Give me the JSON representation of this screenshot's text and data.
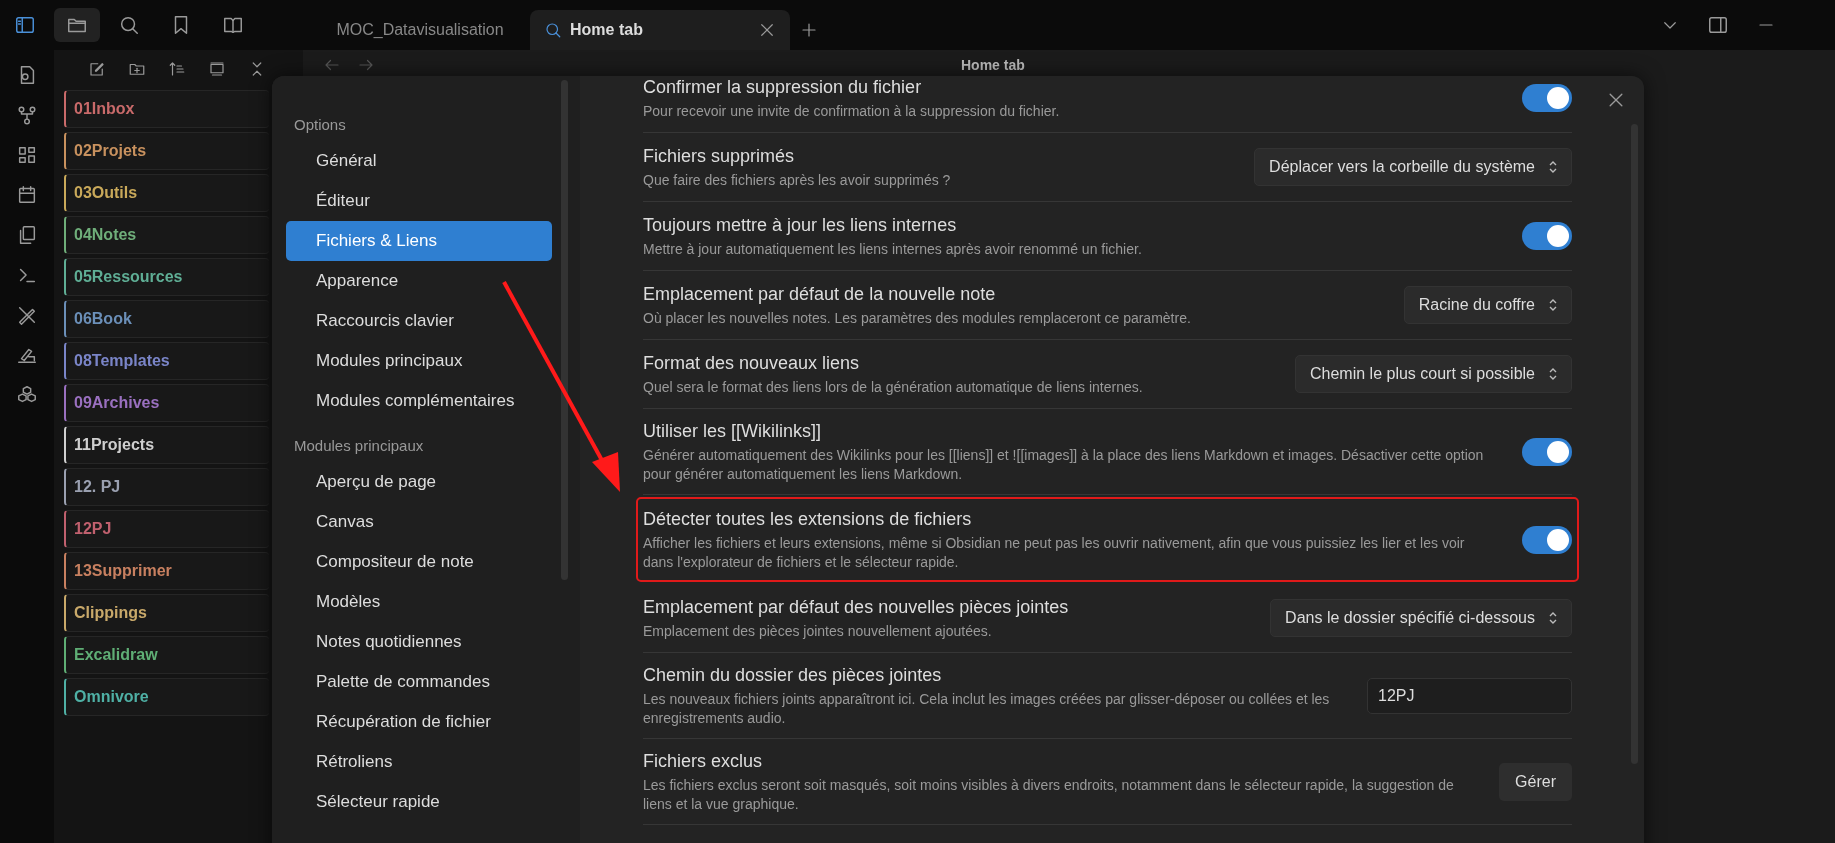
{
  "tabs": [
    {
      "label": "MOC_Datavisualisation",
      "selected": false
    },
    {
      "label": "Home tab",
      "selected": true
    }
  ],
  "view_title": "Home tab",
  "folders": [
    {
      "name": "01Inbox",
      "color": "#c96a6a"
    },
    {
      "name": "02Projets",
      "color": "#c8915e"
    },
    {
      "name": "03Outils",
      "color": "#c9a95a"
    },
    {
      "name": "04Notes",
      "color": "#6fae7a"
    },
    {
      "name": "05Ressources",
      "color": "#5fae95"
    },
    {
      "name": "06Book",
      "color": "#6b8fb8"
    },
    {
      "name": "08Templates",
      "color": "#7a85c8"
    },
    {
      "name": "09Archives",
      "color": "#9a70c0"
    },
    {
      "name": "11Projects",
      "color": "#cfcfcf"
    },
    {
      "name": "12. PJ",
      "color": "#9aa0b0"
    },
    {
      "name": "12PJ",
      "color": "#c0606e"
    },
    {
      "name": "13Supprimer",
      "color": "#c88060"
    },
    {
      "name": "Clippings",
      "color": "#c9a96a"
    },
    {
      "name": "Excalidraw",
      "color": "#5fae75"
    },
    {
      "name": "Omnivore",
      "color": "#4fb0a5"
    }
  ],
  "settings_nav": [
    {
      "heading": "Options",
      "items": [
        {
          "label": "Général",
          "selected": false
        },
        {
          "label": "Éditeur",
          "selected": false
        },
        {
          "label": "Fichiers & Liens",
          "selected": true
        },
        {
          "label": "Apparence",
          "selected": false
        },
        {
          "label": "Raccourcis clavier",
          "selected": false
        },
        {
          "label": "Modules principaux",
          "selected": false
        },
        {
          "label": "Modules complémentaires",
          "selected": false
        }
      ]
    },
    {
      "heading": "Modules principaux",
      "items": [
        {
          "label": "Aperçu de page",
          "selected": false
        },
        {
          "label": "Canvas",
          "selected": false
        },
        {
          "label": "Compositeur de note",
          "selected": false
        },
        {
          "label": "Modèles",
          "selected": false
        },
        {
          "label": "Notes quotidiennes",
          "selected": false
        },
        {
          "label": "Palette de commandes",
          "selected": false
        },
        {
          "label": "Récupération de fichier",
          "selected": false
        },
        {
          "label": "Rétroliens",
          "selected": false
        },
        {
          "label": "Sélecteur rapide",
          "selected": false
        }
      ]
    }
  ],
  "settings": [
    {
      "kind": "toggle",
      "title": "Confirmer la suppression du fichier",
      "description": "Pour recevoir une invite de confirmation à la suppression du fichier.",
      "on": true,
      "highlighted": false
    },
    {
      "kind": "dropdown",
      "title": "Fichiers supprimés",
      "description": "Que faire des fichiers après les avoir supprimés ?",
      "value": "Déplacer vers la corbeille du système",
      "highlighted": false
    },
    {
      "kind": "toggle",
      "title": "Toujours mettre à jour les liens internes",
      "description": "Mettre à jour automatiquement les liens internes après avoir renommé un fichier.",
      "on": true,
      "highlighted": false
    },
    {
      "kind": "dropdown",
      "title": "Emplacement par défaut de la nouvelle note",
      "description": "Où placer les nouvelles notes. Les paramètres des modules remplaceront ce paramètre.",
      "value": "Racine du coffre",
      "highlighted": false
    },
    {
      "kind": "dropdown",
      "title": "Format des nouveaux liens",
      "description": "Quel sera le format des liens lors de la génération automatique de liens internes.",
      "value": "Chemin le plus court si possible",
      "highlighted": false
    },
    {
      "kind": "toggle",
      "title": "Utiliser les [[Wikilinks]]",
      "description": "Générer automatiquement des Wikilinks pour les [[liens]] et ![[images]] à la place des liens Markdown et images. Désactiver cette option pour générer automatiquement les liens Markdown.",
      "on": true,
      "highlighted": false
    },
    {
      "kind": "toggle",
      "title": "Détecter toutes les extensions de fichiers",
      "description": "Afficher les fichiers et leurs extensions, même si Obsidian ne peut pas les ouvrir nativement, afin que vous puissiez les lier et les voir dans l'explorateur de fichiers et le sélecteur rapide.",
      "on": true,
      "highlighted": true
    },
    {
      "kind": "dropdown",
      "title": "Emplacement par défaut des nouvelles pièces jointes",
      "description": "Emplacement des pièces jointes nouvellement ajoutées.",
      "value": "Dans le dossier spécifié ci-dessous",
      "highlighted": false
    },
    {
      "kind": "text",
      "title": "Chemin du dossier des pièces jointes",
      "description": "Les nouveaux fichiers joints apparaîtront ici. Cela inclut les images créées par glisser-déposer ou collées et les enregistrements audio.",
      "value": "12PJ",
      "highlighted": false
    },
    {
      "kind": "button",
      "title": "Fichiers exclus",
      "description": "Les fichiers exclus seront soit masqués, soit moins visibles à divers endroits, notamment dans le sélecteur rapide, la suggestion de liens et la vue graphique.",
      "button": "Gérer",
      "highlighted": false
    }
  ]
}
